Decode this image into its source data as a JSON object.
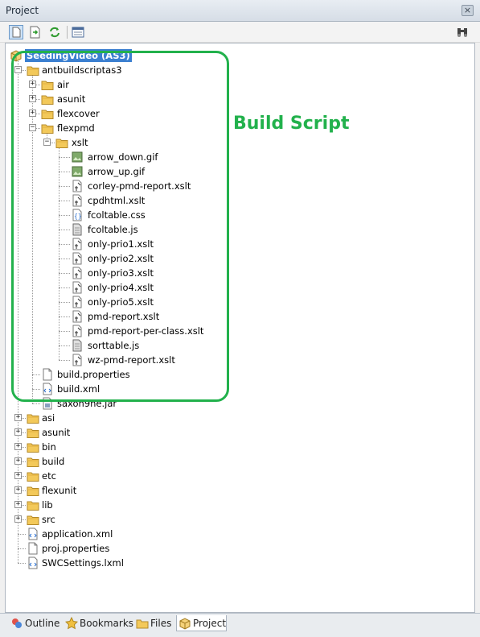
{
  "panel": {
    "title": "Project",
    "close_label": "×"
  },
  "toolbar": {
    "buttons": [
      "new-file",
      "sync-file",
      "refresh",
      "properties",
      "find"
    ]
  },
  "tree": {
    "root": "SeedingVideo (AS3)",
    "items": [
      {
        "label": "antbuildscriptas3",
        "type": "folder",
        "expanded": true
      },
      {
        "label": "air",
        "type": "folder"
      },
      {
        "label": "asunit",
        "type": "folder"
      },
      {
        "label": "flexcover",
        "type": "folder"
      },
      {
        "label": "flexpmd",
        "type": "folder",
        "expanded": true
      },
      {
        "label": "xslt",
        "type": "folder",
        "expanded": true
      },
      {
        "label": "arrow_down.gif",
        "type": "image"
      },
      {
        "label": "arrow_up.gif",
        "type": "image"
      },
      {
        "label": "corley-pmd-report.xslt",
        "type": "xslt"
      },
      {
        "label": "cpdhtml.xslt",
        "type": "xslt"
      },
      {
        "label": "fcoltable.css",
        "type": "css"
      },
      {
        "label": "fcoltable.js",
        "type": "js"
      },
      {
        "label": "only-prio1.xslt",
        "type": "xslt"
      },
      {
        "label": "only-prio2.xslt",
        "type": "xslt"
      },
      {
        "label": "only-prio3.xslt",
        "type": "xslt"
      },
      {
        "label": "only-prio4.xslt",
        "type": "xslt"
      },
      {
        "label": "only-prio5.xslt",
        "type": "xslt"
      },
      {
        "label": "pmd-report.xslt",
        "type": "xslt"
      },
      {
        "label": "pmd-report-per-class.xslt",
        "type": "xslt"
      },
      {
        "label": "sorttable.js",
        "type": "js"
      },
      {
        "label": "wz-pmd-report.xslt",
        "type": "xslt"
      },
      {
        "label": "build.properties",
        "type": "file"
      },
      {
        "label": "build.xml",
        "type": "xml"
      },
      {
        "label": "saxon9he.jar",
        "type": "jar"
      },
      {
        "label": "asi",
        "type": "folder"
      },
      {
        "label": "asunit",
        "type": "folder"
      },
      {
        "label": "bin",
        "type": "folder"
      },
      {
        "label": "build",
        "type": "folder"
      },
      {
        "label": "etc",
        "type": "folder"
      },
      {
        "label": "flexunit",
        "type": "folder"
      },
      {
        "label": "lib",
        "type": "folder"
      },
      {
        "label": "src",
        "type": "folder"
      },
      {
        "label": "application.xml",
        "type": "xml"
      },
      {
        "label": "proj.properties",
        "type": "file"
      },
      {
        "label": "SWCSettings.lxml",
        "type": "xml"
      }
    ]
  },
  "annotation": {
    "text": "Build Script",
    "color": "#22b14c"
  },
  "tabs": [
    {
      "label": "Outline",
      "icon": "outline-icon",
      "active": false
    },
    {
      "label": "Bookmarks",
      "icon": "star-icon",
      "active": false
    },
    {
      "label": "Files",
      "icon": "files-icon",
      "active": false
    },
    {
      "label": "Project",
      "icon": "project-icon",
      "active": true
    }
  ],
  "colors": {
    "selection": "#3b7fd0",
    "folder": "#f3c95a",
    "annotation": "#22b14c"
  }
}
